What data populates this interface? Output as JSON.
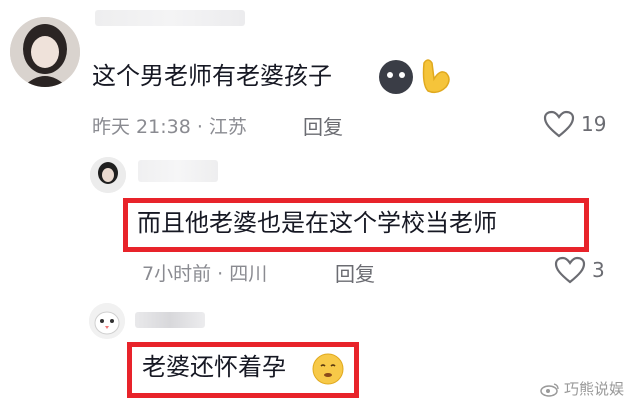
{
  "comments": [
    {
      "text": "这个男老师有老婆孩子",
      "meta": "昨天 21:38 · 江苏",
      "reply_label": "回复",
      "like_count": "19"
    },
    {
      "text": "而且他老婆也是在这个学校当老师",
      "meta": "7小时前 · 四川",
      "reply_label": "回复",
      "like_count": "3"
    },
    {
      "text": "老婆还怀着孕"
    }
  ],
  "watermark": {
    "text": "巧熊说娱"
  },
  "colors": {
    "highlight": "#e8232a",
    "meta": "#8a8b91"
  }
}
